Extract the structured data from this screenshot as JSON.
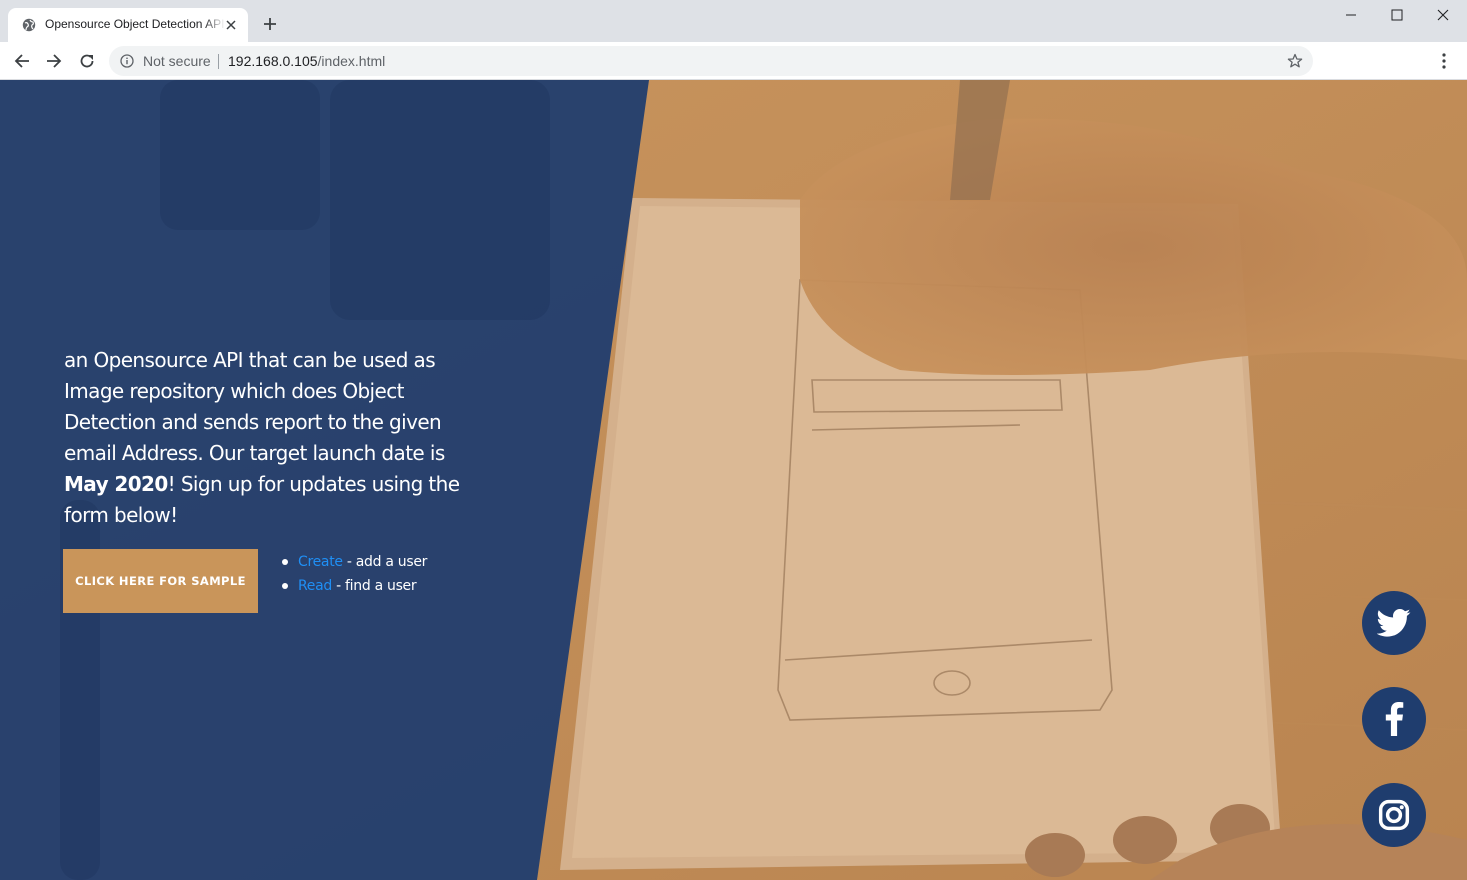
{
  "browser": {
    "tab_title": "Opensource Object Detection API",
    "security_label": "Not secure",
    "url_host": "192.168.0.105",
    "url_path": "/index.html"
  },
  "main": {
    "intro_before": "an Opensource API that can be used as Image repository which does Object Detection and sends report to the given email Address. Our target launch date is ",
    "intro_bold": "May 2020",
    "intro_after": "! Sign up for updates using the form below!",
    "sample_button_label": "CLICK HERE FOR SAMPLE",
    "links": [
      {
        "link_text": "Create",
        "description": " - add a user"
      },
      {
        "link_text": "Read",
        "description": " - find a user"
      }
    ]
  },
  "social": {
    "icons": [
      "twitter-icon",
      "facebook-icon",
      "instagram-icon"
    ]
  },
  "colors": {
    "overlay_blue": "#1f3d6e",
    "button_tan": "#c9955a",
    "link_blue": "#1f8ff5",
    "social_circle": "#1f3d6e"
  }
}
